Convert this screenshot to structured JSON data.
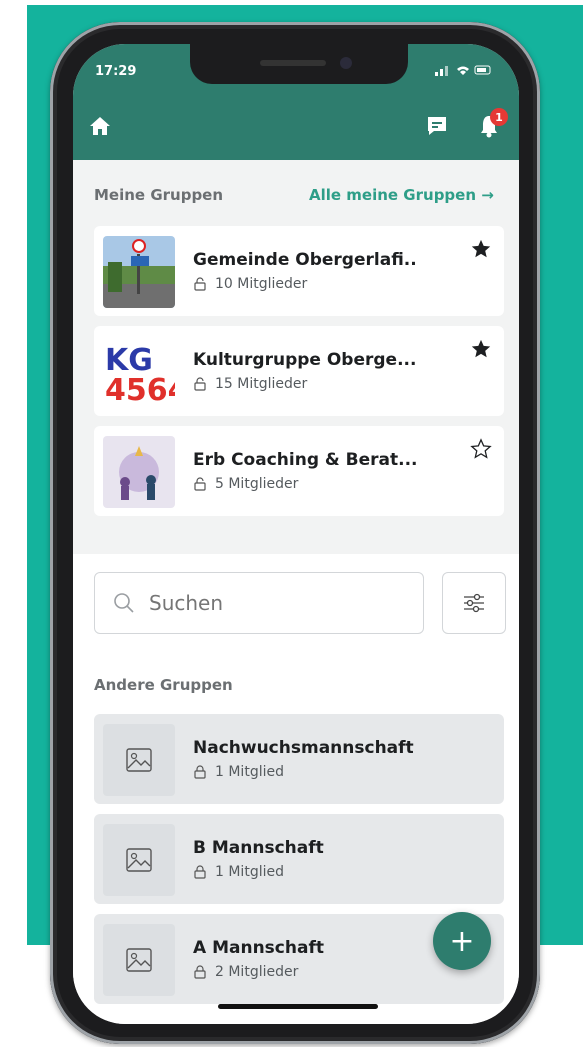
{
  "status_bar": {
    "time": "17:29",
    "icons": "signal wifi battery"
  },
  "header": {
    "home_icon": "home-icon",
    "chat_icon": "chat-icon",
    "bell_icon": "bell-icon",
    "notification_count": "1"
  },
  "my_groups": {
    "title": "Meine Gruppen",
    "all_link": "Alle meine Gruppen →",
    "items": [
      {
        "name": "Gemeinde Obergerlafi..",
        "members": "10 Mitglieder",
        "starred": true
      },
      {
        "name": "Kulturgruppe Oberge...",
        "members": "15 Mitglieder",
        "starred": true,
        "logo_text": "KG 4564"
      },
      {
        "name": "Erb Coaching & Berat...",
        "members": "5 Mitglieder",
        "starred": false
      }
    ]
  },
  "search": {
    "placeholder": "Suchen"
  },
  "other_groups": {
    "title": "Andere Gruppen",
    "items": [
      {
        "name": "Nachwuchsmannschaft",
        "members": "1 Mitglied"
      },
      {
        "name": "B Mannschaft",
        "members": "1 Mitglied"
      },
      {
        "name": "A Mannschaft",
        "members": "2 Mitglieder"
      }
    ]
  },
  "fab": {
    "label": "+"
  },
  "colors": {
    "brand": "#2e7d6e",
    "accent": "#2e9e88",
    "background": "#14b39d",
    "badge": "#e53935"
  }
}
